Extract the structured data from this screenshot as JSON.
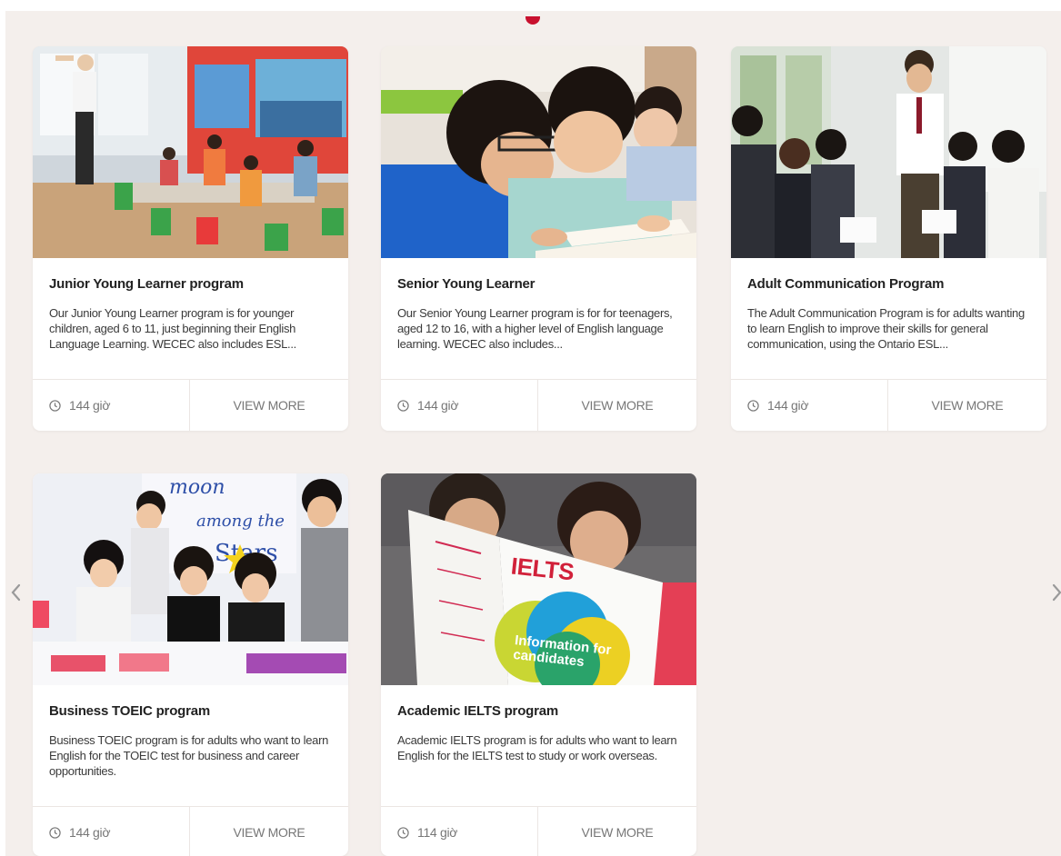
{
  "courses": [
    {
      "title": "Junior Young Learner program",
      "description": "Our Junior Young Learner program is for younger children, aged 6 to 11, just beginning their English Language Learning. WECEC also includes ESL...",
      "hours": "144 giờ",
      "more_label": "VIEW MORE"
    },
    {
      "title": "Senior Young Learner",
      "description": "Our Senior Young Learner program is for for teenagers, aged 12 to 16, with a higher level of English language learning. WECEC also includes...",
      "hours": "144 giờ",
      "more_label": "VIEW MORE"
    },
    {
      "title": "Adult Communication Program",
      "description": "The Adult Communication Program is for adults wanting to learn English to improve their skills for general communication, using the Ontario ESL...",
      "hours": "144 giờ",
      "more_label": "VIEW MORE"
    },
    {
      "title": "Business TOEIC program",
      "description": "Business TOEIC program is for adults who want to learn English for the TOEIC test for business and career opportunities.",
      "hours": "144 giờ",
      "more_label": "VIEW MORE"
    },
    {
      "title": "Academic IELTS program",
      "description": "Academic IELTS program is for adults who want to learn English for the IELTS test to study or work overseas.",
      "hours": "114 giờ",
      "more_label": "VIEW MORE"
    }
  ],
  "photos": {
    "ielts_magazine_logo": "IELTS",
    "ielts_magazine_caption": "Information for candidates"
  },
  "colors": {
    "accent": "#c8102e",
    "section_background": "#f4efec",
    "muted_text": "#777777"
  },
  "icons": {
    "hours": "clock-icon",
    "prev": "chevron-left-icon",
    "next": "chevron-right-icon"
  }
}
